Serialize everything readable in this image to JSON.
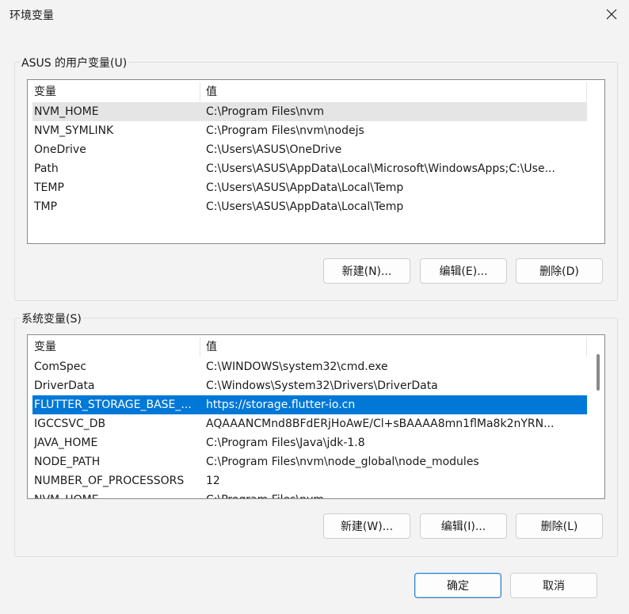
{
  "window": {
    "title": "环境变量"
  },
  "user_vars": {
    "group_title": "ASUS 的用户变量(U)",
    "col_name": "变量",
    "col_value": "值",
    "rows": [
      {
        "name": "NVM_HOME",
        "value": "C:\\Program Files\\nvm"
      },
      {
        "name": "NVM_SYMLINK",
        "value": "C:\\Program Files\\nvm\\nodejs"
      },
      {
        "name": "OneDrive",
        "value": "C:\\Users\\ASUS\\OneDrive"
      },
      {
        "name": "Path",
        "value": "C:\\Users\\ASUS\\AppData\\Local\\Microsoft\\WindowsApps;C:\\Use..."
      },
      {
        "name": "TEMP",
        "value": "C:\\Users\\ASUS\\AppData\\Local\\Temp"
      },
      {
        "name": "TMP",
        "value": "C:\\Users\\ASUS\\AppData\\Local\\Temp"
      }
    ],
    "buttons": {
      "new": "新建(N)...",
      "edit": "编辑(E)...",
      "delete": "删除(D)"
    }
  },
  "system_vars": {
    "group_title": "系统变量(S)",
    "col_name": "变量",
    "col_value": "值",
    "rows": [
      {
        "name": "ComSpec",
        "value": "C:\\WINDOWS\\system32\\cmd.exe"
      },
      {
        "name": "DriverData",
        "value": "C:\\Windows\\System32\\Drivers\\DriverData"
      },
      {
        "name": "FLUTTER_STORAGE_BASE_...",
        "value": "https://storage.flutter-io.cn"
      },
      {
        "name": "IGCCSVC_DB",
        "value": "AQAAANCMnd8BFdERjHoAwE/Cl+sBAAAA8mn1flMa8k2nYRN..."
      },
      {
        "name": "JAVA_HOME",
        "value": "C:\\Program Files\\Java\\jdk-1.8"
      },
      {
        "name": "NODE_PATH",
        "value": "C:\\Program Files\\nvm\\node_global\\node_modules"
      },
      {
        "name": "NUMBER_OF_PROCESSORS",
        "value": "12"
      },
      {
        "name": "NVM_HOME",
        "value": "C:\\Program Files\\nvm"
      }
    ],
    "buttons": {
      "new": "新建(W)...",
      "edit": "编辑(I)...",
      "delete": "删除(L)"
    }
  },
  "footer": {
    "ok": "确定",
    "cancel": "取消"
  },
  "colors": {
    "selection": "#0078d7"
  }
}
